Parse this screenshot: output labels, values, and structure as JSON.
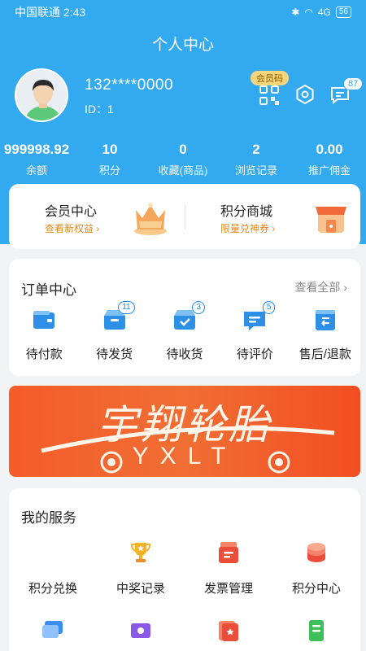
{
  "status": {
    "carrier_time": "中国联通 2:43",
    "signal": "4G",
    "battery": "56"
  },
  "header": {
    "title": "个人中心"
  },
  "profile": {
    "phone": "132****0000",
    "id_label": "ID：1",
    "member_code": "会员码",
    "message_count": "87"
  },
  "stats": [
    {
      "value": "999998.92",
      "label": "余额"
    },
    {
      "value": "10",
      "label": "积分"
    },
    {
      "value": "0",
      "label": "收藏(商品)"
    },
    {
      "value": "2",
      "label": "浏览记录"
    },
    {
      "value": "0.00",
      "label": "推广佣金"
    }
  ],
  "member": {
    "left": {
      "title": "会员中心",
      "sub": "查看新权益 ›"
    },
    "right": {
      "title": "积分商城",
      "sub": "限量兑神券 ›"
    }
  },
  "orders": {
    "title": "订单中心",
    "see_all": "查看全部 ›",
    "items": [
      {
        "label": "待付款",
        "badge": ""
      },
      {
        "label": "待发货",
        "badge": "11"
      },
      {
        "label": "待收货",
        "badge": "3"
      },
      {
        "label": "待评价",
        "badge": "5"
      },
      {
        "label": "售后/退款",
        "badge": ""
      }
    ]
  },
  "banner": {
    "main": "宇翔轮胎",
    "sub": "YXLT"
  },
  "services": {
    "title": "我的服务",
    "items": [
      {
        "label": "积分兑换"
      },
      {
        "label": "中奖记录"
      },
      {
        "label": "发票管理"
      },
      {
        "label": "积分中心"
      }
    ]
  },
  "colors": {
    "primary": "#33aaf0",
    "accent_orange": "#e08a1e",
    "icon_blue": "#1e88e5"
  }
}
